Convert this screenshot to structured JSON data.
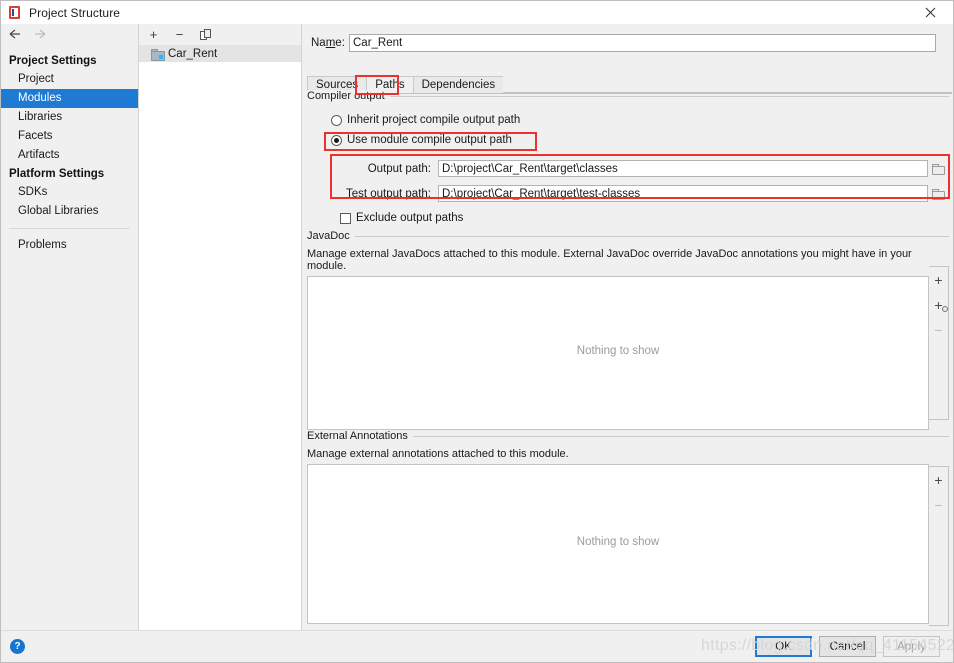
{
  "window": {
    "title": "Project Structure",
    "close_label": "✕",
    "app_icon": "intellij-project-structure-icon"
  },
  "nav": {
    "back_label": "←",
    "forward_label": "→"
  },
  "sidebar": {
    "groups": [
      {
        "title": "Project Settings",
        "items": [
          {
            "label": "Project",
            "selected": false
          },
          {
            "label": "Modules",
            "selected": true
          },
          {
            "label": "Libraries",
            "selected": false
          },
          {
            "label": "Facets",
            "selected": false
          },
          {
            "label": "Artifacts",
            "selected": false
          }
        ]
      },
      {
        "title": "Platform Settings",
        "items": [
          {
            "label": "SDKs",
            "selected": false
          },
          {
            "label": "Global Libraries",
            "selected": false
          }
        ]
      }
    ],
    "problems_label": "Problems"
  },
  "tree": {
    "toolbar": {
      "add_label": "+",
      "remove_label": "−",
      "copy_label": "⧉"
    },
    "nodes": [
      {
        "label": "Car_Rent",
        "selected": true
      }
    ]
  },
  "module": {
    "name_label": "Name:",
    "name_value": "Car_Rent",
    "tabs": [
      {
        "label": "Sources",
        "active": false
      },
      {
        "label": "Paths",
        "active": true
      },
      {
        "label": "Dependencies",
        "active": false
      }
    ]
  },
  "compiler_output": {
    "group_title": "Compiler output",
    "inherit_label": "Inherit project compile output path",
    "inherit_checked": false,
    "module_label": "Use module compile output path",
    "module_checked": true,
    "output_path_label": "Output path:",
    "output_path_value": "D:\\project\\Car_Rent\\target\\classes",
    "test_output_path_label": "Test output path:",
    "test_output_path_value": "D:\\project\\Car_Rent\\target\\test-classes",
    "exclude_label": "Exclude output paths",
    "exclude_checked": false,
    "browse_icon": "folder-browse-icon"
  },
  "javadoc": {
    "group_title": "JavaDoc",
    "description": "Manage external JavaDocs attached to this module. External JavaDoc override JavaDoc annotations you might have in your module.",
    "empty_text": "Nothing to show",
    "buttons": [
      {
        "name": "add-javadoc-path-button",
        "label": "+",
        "disabled": false,
        "has_globe": false
      },
      {
        "name": "add-javadoc-url-button",
        "label": "+",
        "disabled": false,
        "has_globe": true
      },
      {
        "name": "remove-javadoc-button",
        "label": "−",
        "disabled": true,
        "has_globe": false
      }
    ]
  },
  "external_annotations": {
    "group_title": "External Annotations",
    "description": "Manage external annotations attached to this module.",
    "empty_text": "Nothing to show",
    "buttons": [
      {
        "name": "add-annotation-button",
        "label": "+",
        "disabled": false,
        "has_globe": false
      },
      {
        "name": "remove-annotation-button",
        "label": "−",
        "disabled": true,
        "has_globe": false
      }
    ]
  },
  "footer": {
    "help_label": "?",
    "ok_label": "OK",
    "cancel_label": "Cancel",
    "apply_label": "Apply",
    "apply_disabled": true
  },
  "watermark": {
    "text": "https://blog.csdn.net/qq_41154522"
  },
  "colors": {
    "selection_blue": "#1f7ad4",
    "highlight_red": "#e8332e",
    "window_bg": "#f0f0f0",
    "panel_white": "#ffffff"
  }
}
